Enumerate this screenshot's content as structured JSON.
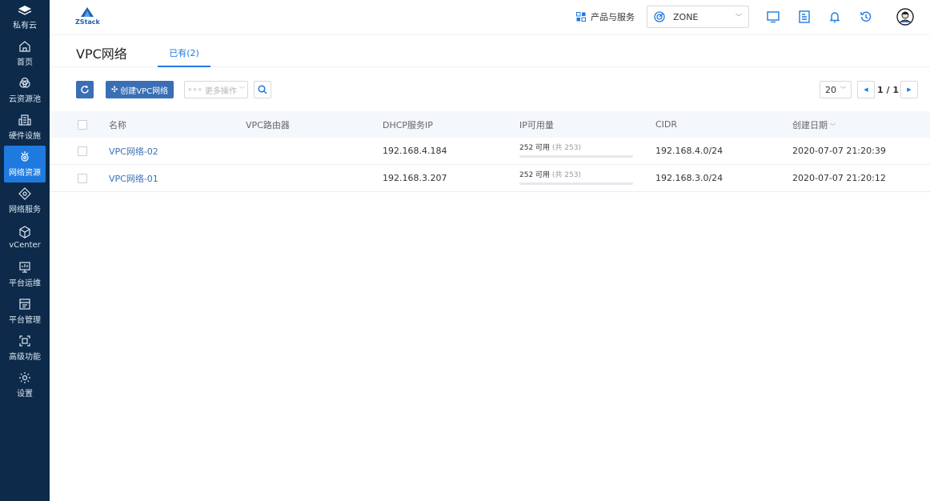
{
  "sidebar": {
    "brand": "私有云",
    "items": [
      {
        "label": "首页"
      },
      {
        "label": "云资源池"
      },
      {
        "label": "硬件设施"
      },
      {
        "label": "网络资源"
      },
      {
        "label": "网络服务"
      },
      {
        "label": "vCenter"
      },
      {
        "label": "平台运维"
      },
      {
        "label": "平台管理"
      },
      {
        "label": "高级功能"
      },
      {
        "label": "设置"
      }
    ],
    "active_index": 3,
    "colors": {
      "background": "#0d2a4a",
      "active": "#1f7ae0"
    }
  },
  "header": {
    "logo_text": "ZStack",
    "products_label": "产品与服务",
    "zone_label": "ZONE",
    "icons": [
      "monitor-icon",
      "document-icon",
      "bell-icon",
      "history-icon",
      "user-avatar-icon"
    ]
  },
  "page": {
    "title": "VPC网络",
    "tab_label": "已有(2)"
  },
  "toolbar": {
    "create_label": "创建VPC网络",
    "more_label": "更多操作",
    "page_size": "20",
    "pager": "1 / 1"
  },
  "table": {
    "columns": {
      "name": "名称",
      "router": "VPC路由器",
      "dhcp": "DHCP服务IP",
      "ip": "IP可用量",
      "cidr": "CIDR",
      "date": "创建日期"
    },
    "rows": [
      {
        "name": "VPC网络-02",
        "router": "",
        "dhcp": "192.168.4.184",
        "ip_available": "252 可用",
        "ip_total": "(共 253)",
        "ip_used_fraction": 0.004,
        "cidr": "192.168.4.0/24",
        "date": "2020-07-07 21:20:39"
      },
      {
        "name": "VPC网络-01",
        "router": "",
        "dhcp": "192.168.3.207",
        "ip_available": "252 可用",
        "ip_total": "(共 253)",
        "ip_used_fraction": 0.004,
        "cidr": "192.168.3.0/24",
        "date": "2020-07-07 21:20:12"
      }
    ]
  }
}
